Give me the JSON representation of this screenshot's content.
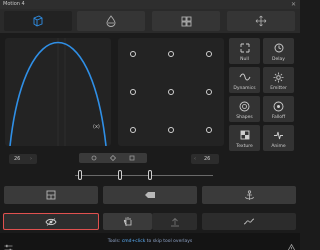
{
  "window": {
    "title": "Motion 4",
    "close_glyph": "✕"
  },
  "top_tabs": [
    {
      "icon": "cube-icon"
    },
    {
      "icon": "drop-icon"
    },
    {
      "icon": "grid-icon"
    },
    {
      "icon": "move-icon"
    }
  ],
  "graph": {
    "label": "(x)"
  },
  "tools": [
    {
      "label": "Null",
      "icon": "null-icon"
    },
    {
      "label": "Delay",
      "icon": "delay-icon"
    },
    {
      "label": "Dynamics",
      "icon": "dynamics-icon"
    },
    {
      "label": "Emitter",
      "icon": "emitter-icon"
    },
    {
      "label": "Shapes",
      "icon": "shapes-icon"
    },
    {
      "label": "Falloff",
      "icon": "falloff-icon"
    },
    {
      "label": "Texture",
      "icon": "texture-icon"
    },
    {
      "label": "Anime",
      "icon": "anime-icon"
    }
  ],
  "controls": {
    "left_value": "26",
    "right_value": "26"
  },
  "footer": {
    "hint_prefix": "Tools: ",
    "hint_key": "cmd+click",
    "hint_suffix": " to skip tool overlays"
  },
  "colors": {
    "accent": "#2f8fe6",
    "selected_outline": "#e0514f"
  }
}
